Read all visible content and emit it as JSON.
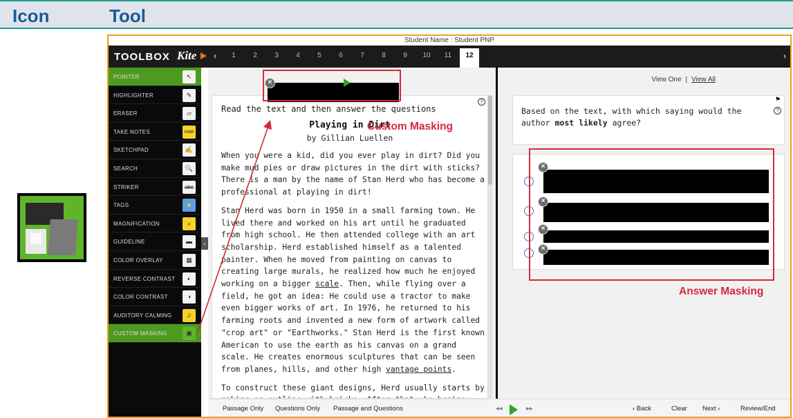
{
  "header": {
    "col_icon": "Icon",
    "col_tool": "Tool"
  },
  "student_name": "Student Name : Student PNP",
  "toolbox": {
    "title": "TOOLBOX",
    "brand": "Kite",
    "items": [
      {
        "label": "POINTER",
        "icon": "pointer-icon",
        "glyph": "↖"
      },
      {
        "label": "HIGHLIGHTER",
        "icon": "highlighter-icon",
        "glyph": "✎"
      },
      {
        "label": "ERASER",
        "icon": "eraser-icon",
        "glyph": "▱"
      },
      {
        "label": "TAKE NOTES",
        "icon": "note-icon",
        "glyph": "note"
      },
      {
        "label": "SKETCHPAD",
        "icon": "sketchpad-icon",
        "glyph": "✍"
      },
      {
        "label": "SEARCH",
        "icon": "search-icon",
        "glyph": "🔍"
      },
      {
        "label": "STRIKER",
        "icon": "striker-icon",
        "glyph": "abc"
      },
      {
        "label": "TAGS",
        "icon": "star-icon",
        "glyph": "★"
      },
      {
        "label": "MAGNIFICATION",
        "icon": "magnifier-icon",
        "glyph": "⌕"
      },
      {
        "label": "GUIDELINE",
        "icon": "guideline-icon",
        "glyph": "▬"
      },
      {
        "label": "COLOR OVERLAY",
        "icon": "color-overlay-icon",
        "glyph": "▦"
      },
      {
        "label": "REVERSE CONTRAST",
        "icon": "reverse-contrast-icon",
        "glyph": "◐"
      },
      {
        "label": "COLOR CONTRAST",
        "icon": "color-contrast-icon",
        "glyph": "◑"
      },
      {
        "label": "AUDITORY CALMING",
        "icon": "music-icon",
        "glyph": "♫"
      },
      {
        "label": "CUSTOM MASKING",
        "icon": "custom-masking-icon",
        "glyph": "▣"
      }
    ]
  },
  "questions": [
    "1",
    "2",
    "3",
    "4",
    "5",
    "6",
    "7",
    "8",
    "9",
    "10",
    "11",
    "12"
  ],
  "passage": {
    "intro": "Read the text and then answer the questions",
    "title": "Playing in Dirt",
    "author": "by Gillian Luellen",
    "para1": "When you were a kid, did you ever play in dirt? Did you make mud pies or draw pictures in the dirt with sticks? There is a man by the name of Stan Herd who has become a professional at playing in dirt!",
    "para2a": "Stan Herd was born in 1950 in a small farming town. He lived there and worked on his art until he graduated from high school. He then attended college with an art scholarship. Herd established himself as a talented painter. When he moved from painting on canvas to creating large murals, he realized how much he enjoyed working on a bigger ",
    "para2_link1": "scale",
    "para2b": ". Then, while flying over a field, he got an idea: He could use a tractor to make even bigger works of art. In 1976, he returned to his farming roots and invented a new form of artwork called \"crop art\" or \"Earthworks.\" Stan Herd is the first known American to use the earth as his canvas on a grand scale. He creates enormous sculptures that can be seen from planes, hills, and other high ",
    "para2_link2": "vantage points",
    "para2c": ".",
    "para3": "To construct these giant designs, Herd usually starts by making an outline with bricks. After that, he begins"
  },
  "question": {
    "view_one": "View One",
    "view_all": "View All",
    "separator": "|",
    "text_a": "Based on the text, with which saying would the author ",
    "text_bold": "most likely",
    "text_b": " agree?"
  },
  "annotations": {
    "custom_masking": "Custom Masking",
    "answer_masking": "Answer Masking"
  },
  "bottom": {
    "passage_only": "Passage Only",
    "questions_only": "Questions Only",
    "passage_and_questions": "Passage and Questions",
    "back": "‹  Back",
    "clear": "Clear",
    "next": "Next  ›",
    "review_end": "Review/End"
  },
  "colors": {
    "accent_green": "#4e9a21",
    "annotation_red": "#d4283c",
    "frame_orange": "#e8a21c",
    "header_blue": "#1b5a96"
  }
}
